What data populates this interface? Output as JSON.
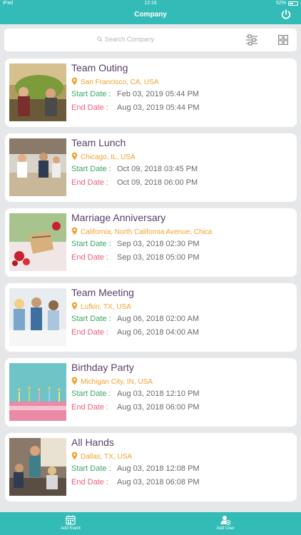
{
  "status": {
    "device": "iPad",
    "time": "12:16",
    "battery": "52%",
    "battery_level": 0.52
  },
  "header": {
    "title": "Company"
  },
  "search": {
    "placeholder": "Search Company"
  },
  "labels": {
    "start": "Start Date :",
    "end": "End Date  :"
  },
  "events": [
    {
      "title": "Team Outing",
      "location": "San Francisco, CA, USA",
      "start": "Feb 03, 2019 05:44 PM",
      "end": "Aug 03, 2019 05:44 PM"
    },
    {
      "title": "Team Lunch",
      "location": "Chicago, IL, USA",
      "start": "Oct 09, 2018 03:45 PM",
      "end": "Oct 09, 2018 06:00 PM"
    },
    {
      "title": "Marriage Anniversary",
      "location": "California, North California Avenue, Chica",
      "start": "Sep 03, 2018 02:30 PM",
      "end": "Sep 03, 2018 05:00 PM"
    },
    {
      "title": "Team Meeting",
      "location": "Lufkin, TX, USA",
      "start": "Aug 06, 2018 02:00 AM",
      "end": "Aug 06, 2018 04:00 AM"
    },
    {
      "title": "Birthday Party",
      "location": "Michigan City, IN, USA",
      "start": "Aug 03, 2018 12:10 PM",
      "end": "Aug 03, 2018 06:00 PM"
    },
    {
      "title": "All Hands",
      "location": "Dallas, TX, USA",
      "start": "Aug 03, 2018 12:08 PM",
      "end": "Aug 03, 2018 06:08 PM"
    }
  ],
  "tabbar": {
    "add_event": "Add Event",
    "add_user": "Add User"
  },
  "colors": {
    "accent": "#33bcb7",
    "title": "#5a3e6b",
    "location": "#f2a230",
    "start_label": "#3aa764",
    "end_label": "#ef5e7c"
  },
  "icons": [
    "power-icon",
    "search-icon",
    "filter-icon",
    "grid-icon",
    "location-pin-icon",
    "calendar-icon",
    "add-user-icon"
  ]
}
